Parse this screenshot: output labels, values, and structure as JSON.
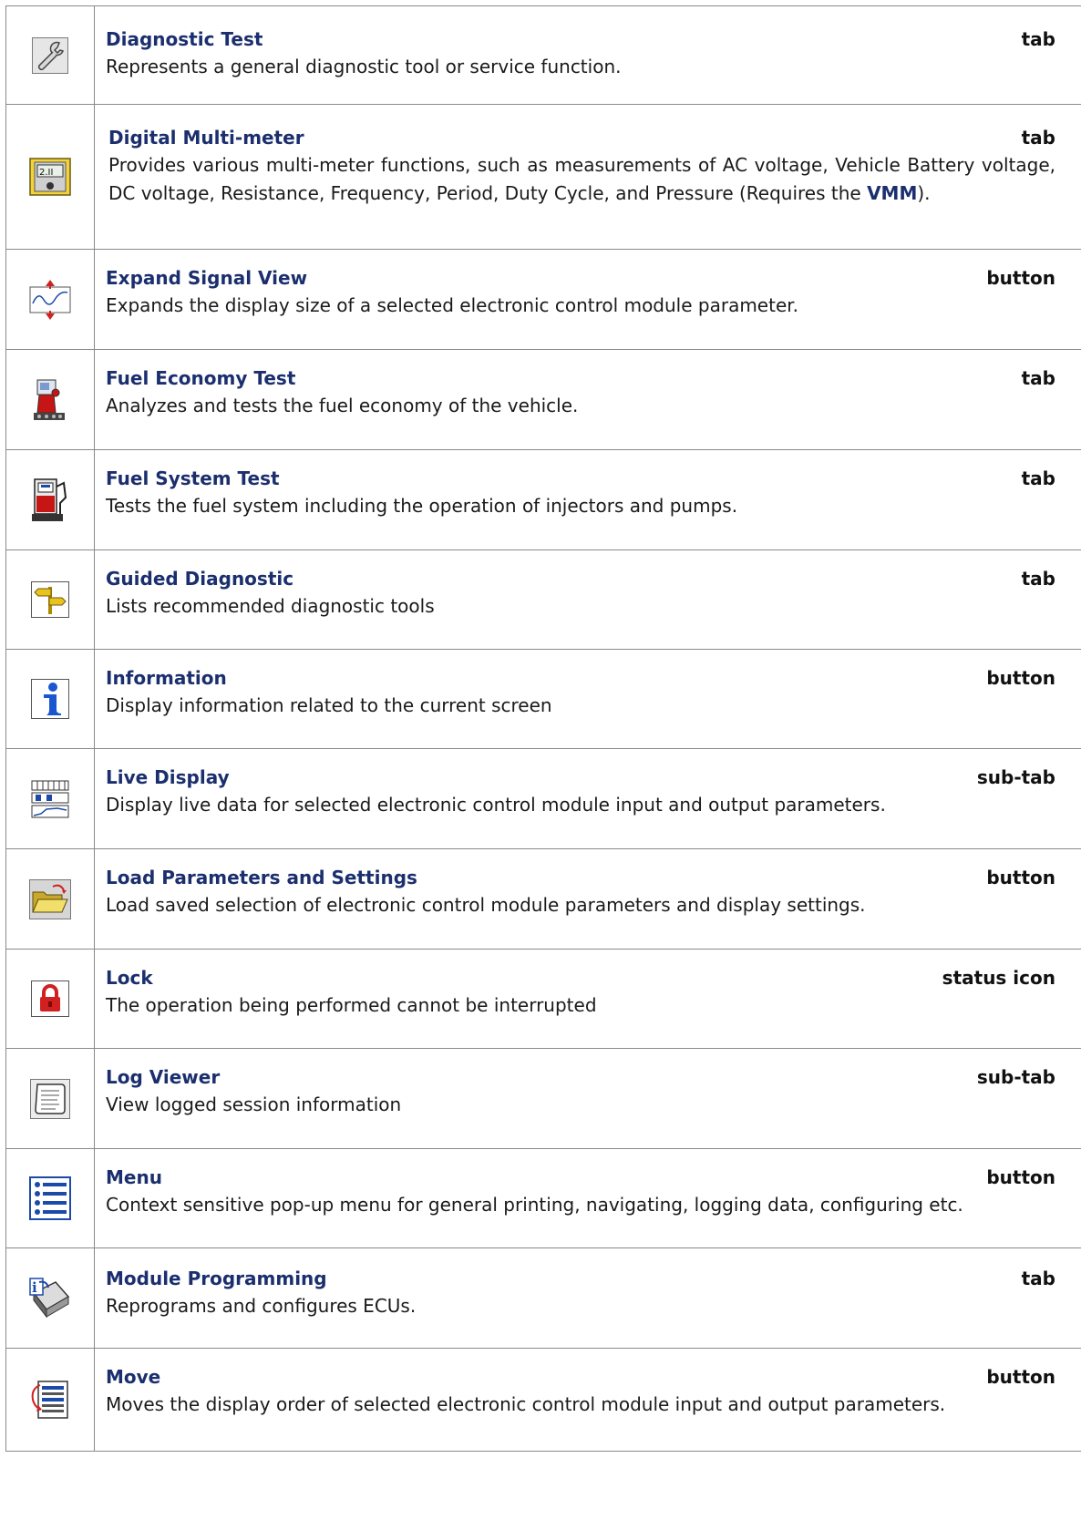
{
  "rows": [
    {
      "title": "Diagnostic Test",
      "type": "tab",
      "icon": "wrench-icon",
      "desc": "Represents a general diagnostic tool or service function."
    },
    {
      "title": "Digital Multi-meter",
      "type": "tab",
      "icon": "multimeter-icon",
      "desc_before": "Provides various multi-meter functions, such as measurements of AC voltage, Vehicle Battery voltage, DC voltage, Resistance, Frequency, Period, Duty Cycle, and Pressure (Requires the ",
      "desc_link": "VMM",
      "desc_after": ").",
      "meter_readout": "2.II"
    },
    {
      "title": "Expand Signal View",
      "type": "button",
      "icon": "expand-signal-icon",
      "desc": "Expands the display size of a selected electronic control module parameter."
    },
    {
      "title": "Fuel Economy Test",
      "type": "tab",
      "icon": "fuel-economy-icon",
      "desc": "Analyzes and tests the fuel economy of the vehicle."
    },
    {
      "title": "Fuel System Test",
      "type": "tab",
      "icon": "fuel-pump-icon",
      "desc": "Tests the fuel system including the operation of injectors and pumps."
    },
    {
      "title": "Guided Diagnostic",
      "type": "tab",
      "icon": "signpost-icon",
      "desc": "Lists recommended diagnostic tools"
    },
    {
      "title": "Information",
      "type": "button",
      "icon": "info-icon",
      "desc": "Display information related to the current screen"
    },
    {
      "title": "Live Display",
      "type": "sub-tab",
      "icon": "live-display-icon",
      "desc": "Display live data for selected electronic control module input and output parameters."
    },
    {
      "title": "Load Parameters and Settings",
      "type": "button",
      "icon": "open-folder-icon",
      "desc": "Load saved selection of electronic control module parameters and display settings."
    },
    {
      "title": "Lock",
      "type": "status icon",
      "icon": "lock-icon",
      "desc": "The operation being performed cannot be interrupted"
    },
    {
      "title": "Log Viewer",
      "type": "sub-tab",
      "icon": "scroll-icon",
      "desc": "View logged session information"
    },
    {
      "title": "Menu",
      "type": "button",
      "icon": "menu-list-icon",
      "desc": "Context sensitive pop-up menu for general printing, navigating, logging data, configuring etc."
    },
    {
      "title": "Module Programming",
      "type": "tab",
      "icon": "module-programming-icon",
      "desc": "Reprograms and configures ECUs."
    },
    {
      "title": "Move",
      "type": "button",
      "icon": "move-order-icon",
      "desc": "Moves the display order of selected electronic control module input and output parameters."
    }
  ]
}
